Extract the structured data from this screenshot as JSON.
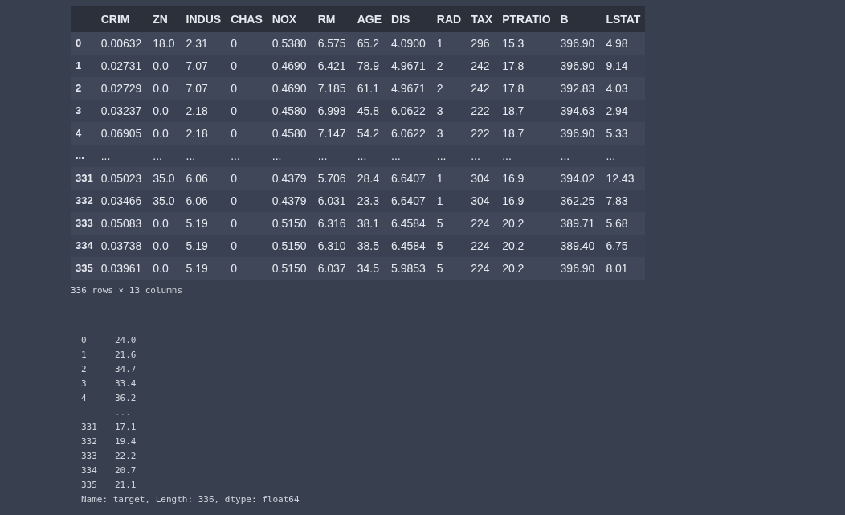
{
  "table": {
    "columns": [
      "CRIM",
      "ZN",
      "INDUS",
      "CHAS",
      "NOX",
      "RM",
      "AGE",
      "DIS",
      "RAD",
      "TAX",
      "PTRATIO",
      "B",
      "LSTAT"
    ],
    "rows": [
      {
        "index": "0",
        "cells": [
          "0.00632",
          "18.0",
          "2.31",
          "0",
          "0.5380",
          "6.575",
          "65.2",
          "4.0900",
          "1",
          "296",
          "15.3",
          "396.90",
          "4.98"
        ]
      },
      {
        "index": "1",
        "cells": [
          "0.02731",
          "0.0",
          "7.07",
          "0",
          "0.4690",
          "6.421",
          "78.9",
          "4.9671",
          "2",
          "242",
          "17.8",
          "396.90",
          "9.14"
        ]
      },
      {
        "index": "2",
        "cells": [
          "0.02729",
          "0.0",
          "7.07",
          "0",
          "0.4690",
          "7.185",
          "61.1",
          "4.9671",
          "2",
          "242",
          "17.8",
          "392.83",
          "4.03"
        ]
      },
      {
        "index": "3",
        "cells": [
          "0.03237",
          "0.0",
          "2.18",
          "0",
          "0.4580",
          "6.998",
          "45.8",
          "6.0622",
          "3",
          "222",
          "18.7",
          "394.63",
          "2.94"
        ]
      },
      {
        "index": "4",
        "cells": [
          "0.06905",
          "0.0",
          "2.18",
          "0",
          "0.4580",
          "7.147",
          "54.2",
          "6.0622",
          "3",
          "222",
          "18.7",
          "396.90",
          "5.33"
        ]
      },
      {
        "index": "...",
        "cells": [
          "...",
          "...",
          "...",
          "...",
          "...",
          "...",
          "...",
          "...",
          "...",
          "...",
          "...",
          "...",
          "..."
        ]
      },
      {
        "index": "331",
        "cells": [
          "0.05023",
          "35.0",
          "6.06",
          "0",
          "0.4379",
          "5.706",
          "28.4",
          "6.6407",
          "1",
          "304",
          "16.9",
          "394.02",
          "12.43"
        ]
      },
      {
        "index": "332",
        "cells": [
          "0.03466",
          "35.0",
          "6.06",
          "0",
          "0.4379",
          "6.031",
          "23.3",
          "6.6407",
          "1",
          "304",
          "16.9",
          "362.25",
          "7.83"
        ]
      },
      {
        "index": "333",
        "cells": [
          "0.05083",
          "0.0",
          "5.19",
          "0",
          "0.5150",
          "6.316",
          "38.1",
          "6.4584",
          "5",
          "224",
          "20.2",
          "389.71",
          "5.68"
        ]
      },
      {
        "index": "334",
        "cells": [
          "0.03738",
          "0.0",
          "5.19",
          "0",
          "0.5150",
          "6.310",
          "38.5",
          "6.4584",
          "5",
          "224",
          "20.2",
          "389.40",
          "6.75"
        ]
      },
      {
        "index": "335",
        "cells": [
          "0.03961",
          "0.0",
          "5.19",
          "0",
          "0.5150",
          "6.037",
          "34.5",
          "5.9853",
          "5",
          "224",
          "20.2",
          "396.90",
          "8.01"
        ]
      }
    ],
    "shape": "336 rows × 13 columns"
  },
  "series": {
    "rows": [
      {
        "index": "0",
        "value": "24.0"
      },
      {
        "index": "1",
        "value": "21.6"
      },
      {
        "index": "2",
        "value": "34.7"
      },
      {
        "index": "3",
        "value": "33.4"
      },
      {
        "index": "4",
        "value": "36.2"
      },
      {
        "value": "..."
      },
      {
        "index": "331",
        "value": "17.1"
      },
      {
        "index": "332",
        "value": "19.4"
      },
      {
        "index": "333",
        "value": "22.2"
      },
      {
        "index": "334",
        "value": "20.7"
      },
      {
        "index": "335",
        "value": "21.1"
      }
    ],
    "footer": "Name: target, Length: 336, dtype: float64"
  }
}
